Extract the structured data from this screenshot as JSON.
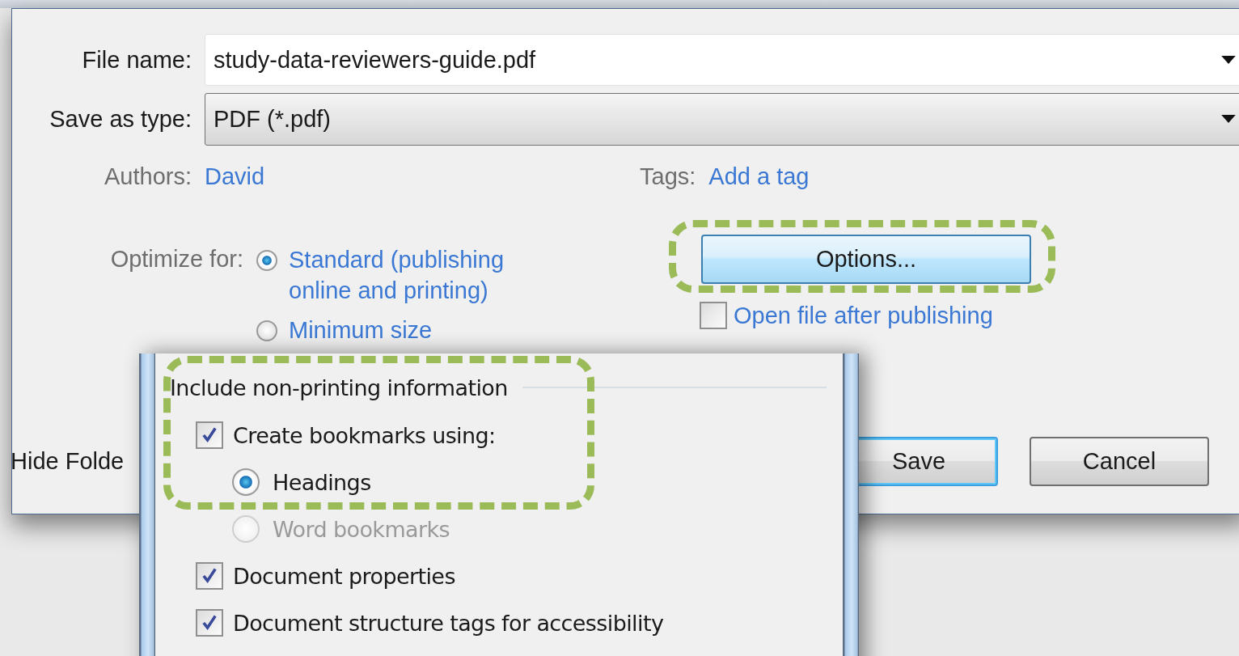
{
  "save_dialog": {
    "file_name": {
      "label": "File name:",
      "value": "study-data-reviewers-guide.pdf"
    },
    "save_as_type": {
      "label": "Save as type:",
      "value": "PDF (*.pdf)"
    },
    "authors": {
      "label": "Authors:",
      "value": "David"
    },
    "tags": {
      "label": "Tags:",
      "value": "Add a tag"
    },
    "optimize_for": {
      "label": "Optimize for:",
      "options": [
        {
          "label": "Standard (publishing online and printing)",
          "selected": true
        },
        {
          "label": "Minimum size",
          "selected": false
        }
      ]
    },
    "options_button": "Options...",
    "open_file_after_publishing": {
      "label": "Open file after publishing",
      "checked": false
    },
    "hide_folders": "Hide Folde",
    "buttons": [
      "Save",
      "Cancel"
    ]
  },
  "options_window": {
    "section": "Include non-printing information",
    "items": [
      {
        "kind": "checkbox",
        "label": "Create bookmarks using:",
        "checked": true,
        "disabled": false
      },
      {
        "kind": "radio",
        "label": "Headings",
        "selected": true,
        "disabled": false
      },
      {
        "kind": "radio",
        "label": "Word bookmarks",
        "selected": false,
        "disabled": true
      },
      {
        "kind": "checkbox",
        "label": "Document properties",
        "checked": true,
        "disabled": false
      },
      {
        "kind": "checkbox",
        "label": "Document structure tags for accessibility",
        "checked": true,
        "disabled": false
      }
    ]
  }
}
